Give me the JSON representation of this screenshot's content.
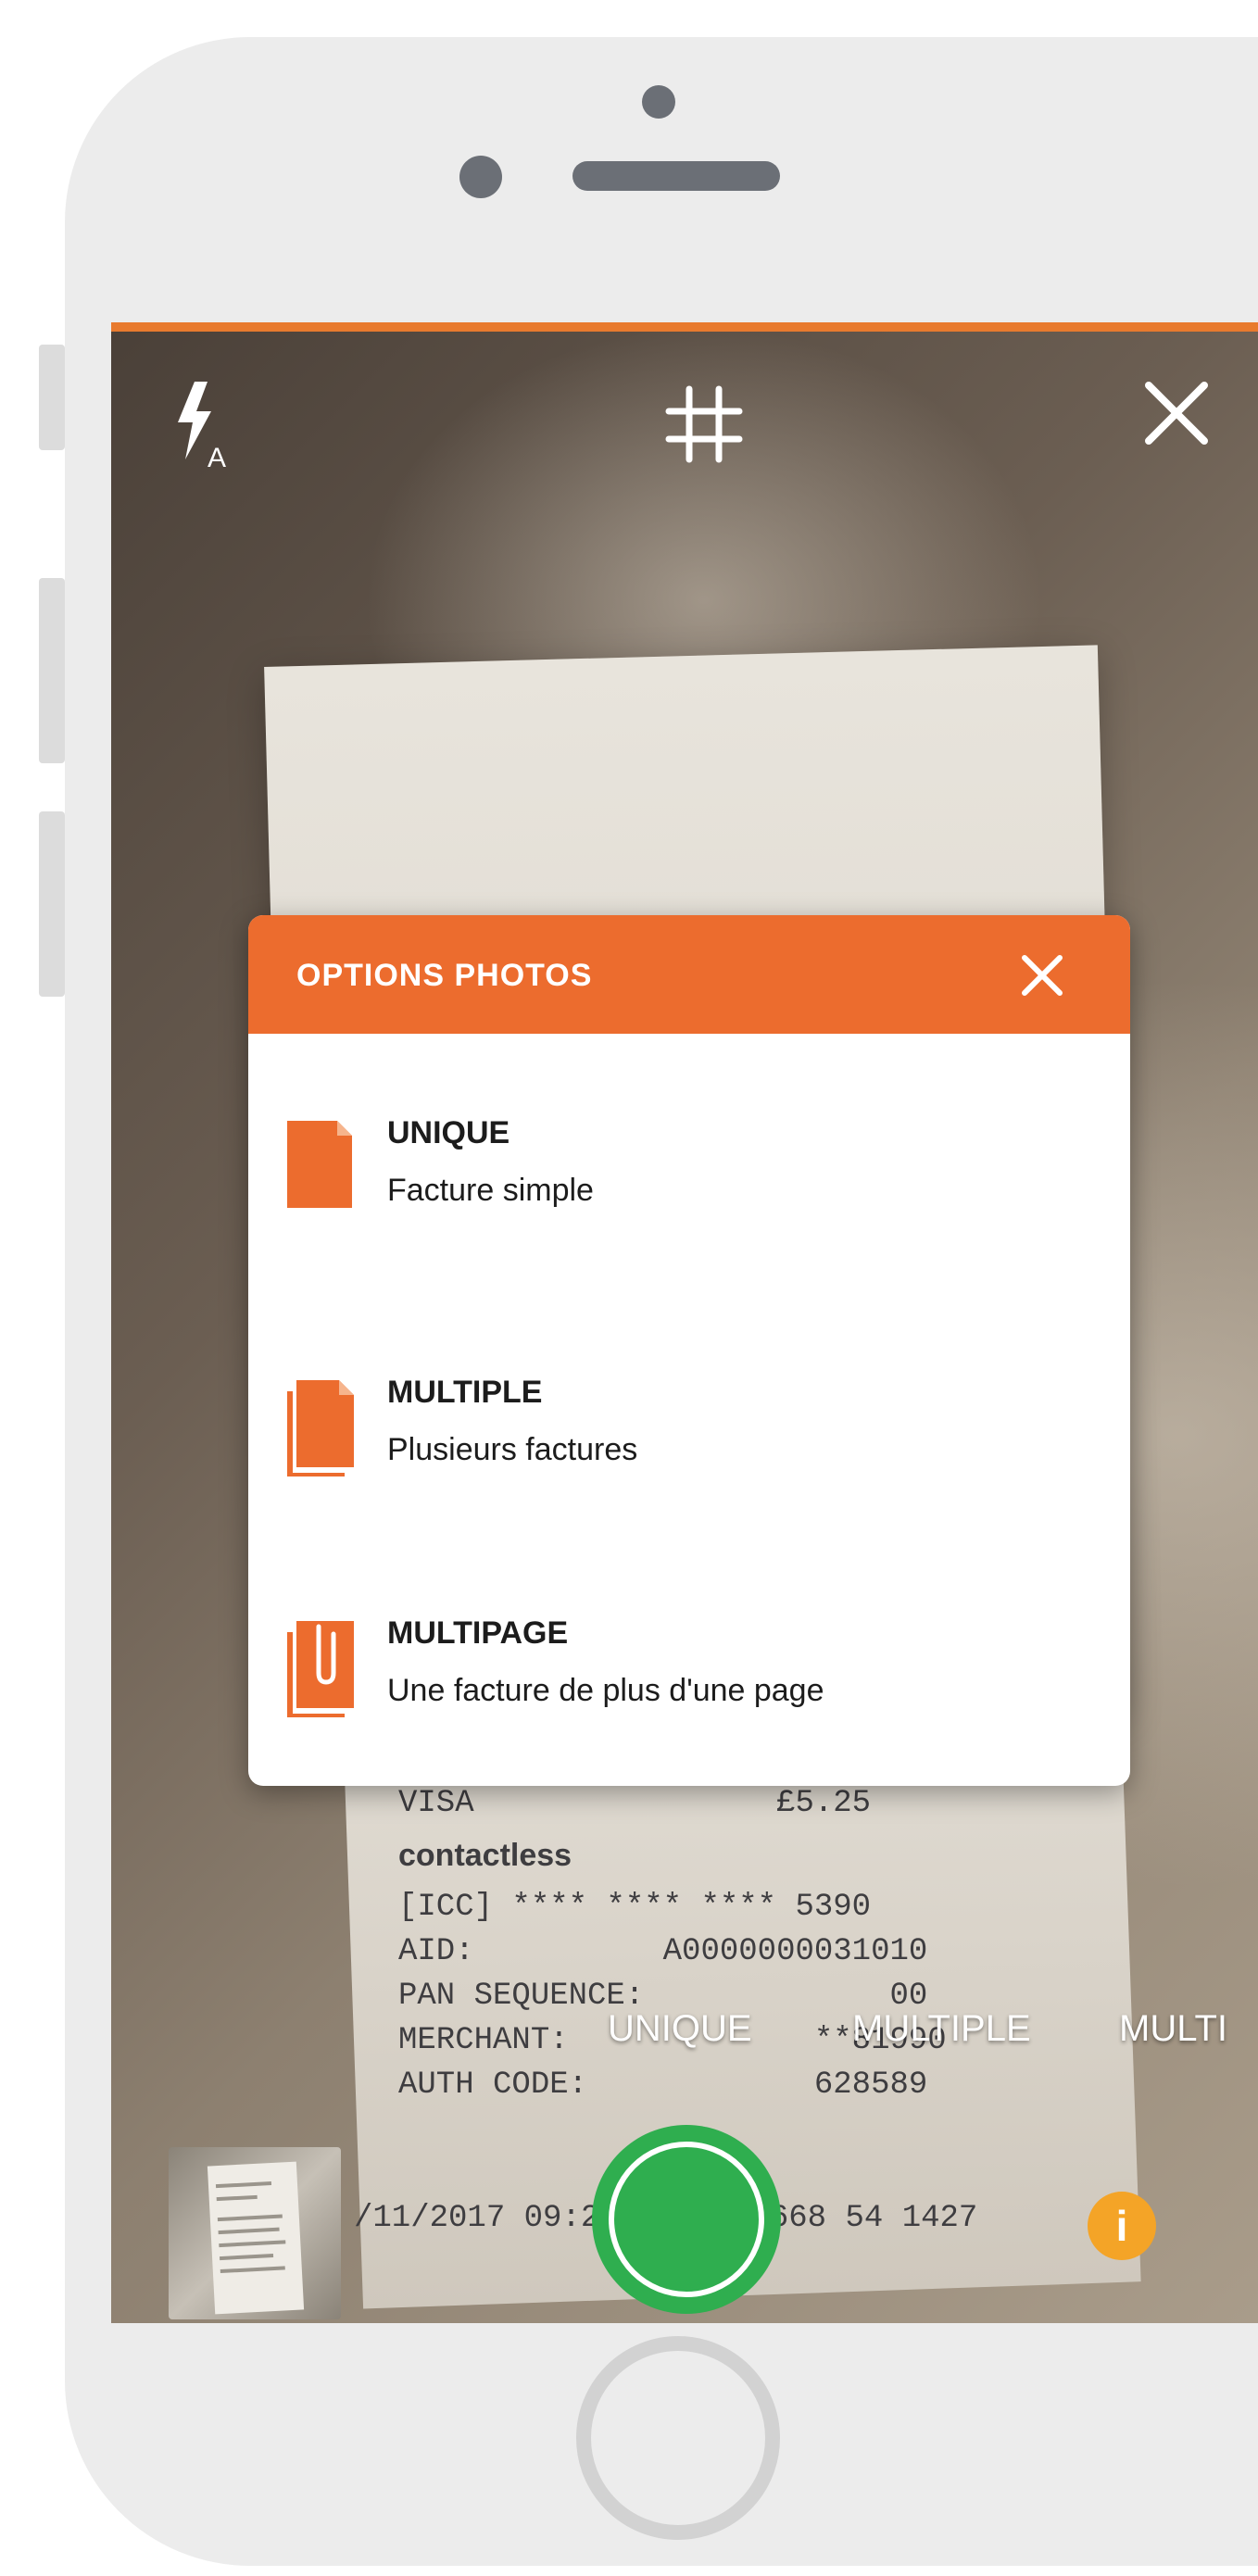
{
  "camera": {
    "flash_mode_label": "A"
  },
  "options_panel": {
    "title": "OPTIONS PHOTOS",
    "options": [
      {
        "title": "UNIQUE",
        "description": "Facture simple"
      },
      {
        "title": "MULTIPLE",
        "description": "Plusieurs factures"
      },
      {
        "title": "MULTIPAGE",
        "description": "Une facture de plus d'une page"
      }
    ]
  },
  "mode_selector": {
    "modes": [
      "UNIQUE",
      "MULTIPLE",
      "MULTI"
    ]
  },
  "info_button": {
    "label": "i"
  },
  "receipt": {
    "lines": [
      "VISA                £5.25",
      "contactless",
      "[ICC] **** **** **** 5390",
      "AID:          A0000000031010",
      "PAN SEQUENCE:             00",
      "MERCHANT:             **81990",
      "AUTH CODE:            628589",
      "/11/2017 09:2       27668 54 1427"
    ]
  },
  "colors": {
    "accent_orange": "#ec6c2e",
    "shutter_green": "#2fae4f",
    "info_yellow": "#f4a427",
    "phone_frame": "#ececec"
  },
  "icons": {
    "flash": "flash-auto-icon",
    "grid": "grid-icon",
    "close": "close-icon",
    "single_doc": "single-document-icon",
    "multi_doc": "multiple-documents-icon",
    "multipage_doc": "multipage-document-icon"
  }
}
